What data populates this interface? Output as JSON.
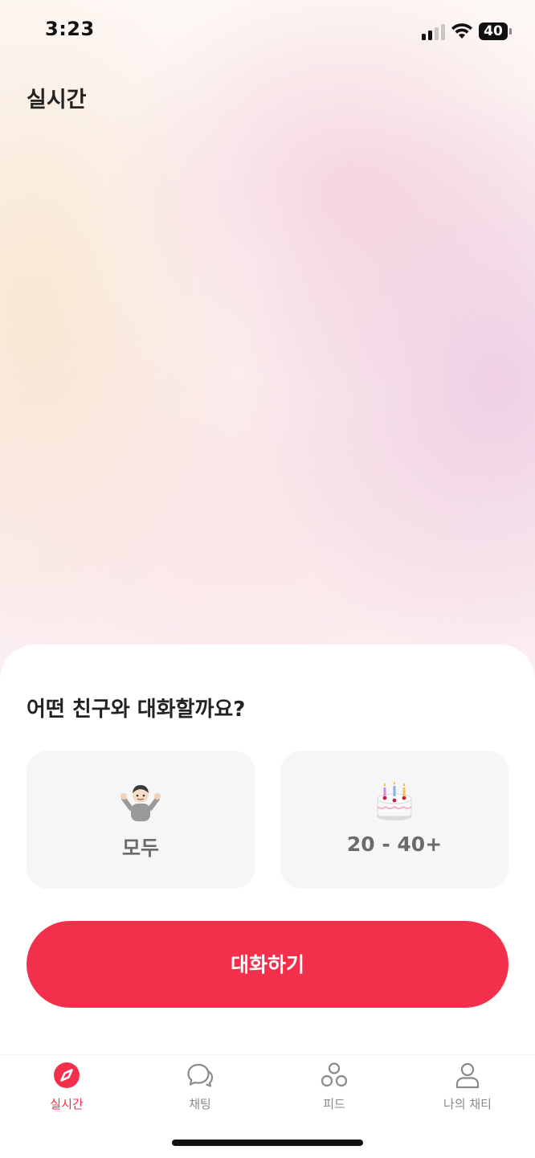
{
  "status_bar": {
    "time": "3:23",
    "battery": "40"
  },
  "header": {
    "title": "실시간"
  },
  "sheet": {
    "question": "어떤 친구와 대화할까요?",
    "options": [
      {
        "icon": "shrugging-person-icon",
        "label": "모두"
      },
      {
        "icon": "birthday-cake-icon",
        "label": "20 - 40+"
      }
    ],
    "cta_label": "대화하기"
  },
  "tabbar": {
    "items": [
      {
        "label": "실시간",
        "icon": "compass-icon",
        "active": true
      },
      {
        "label": "채팅",
        "icon": "chat-bubbles-icon",
        "active": false
      },
      {
        "label": "피드",
        "icon": "feed-circles-icon",
        "active": false
      },
      {
        "label": "나의 채티",
        "icon": "person-icon",
        "active": false
      }
    ]
  },
  "colors": {
    "accent": "#f2304c",
    "card_bg": "#f6f6f6",
    "inactive_tab": "#8a8a8a"
  }
}
